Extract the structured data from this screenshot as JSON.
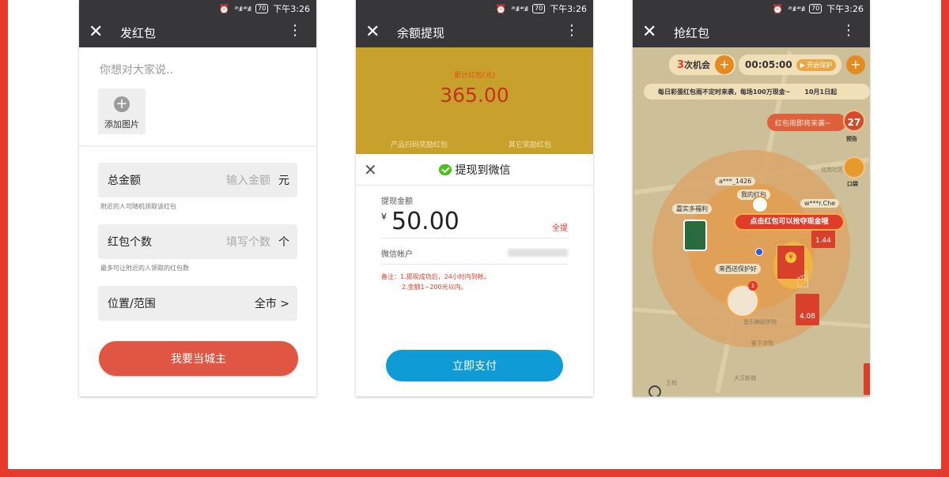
{
  "status": {
    "signal": "²⁶.ıll ⁴⁶.ıll",
    "battery": "70",
    "time": "下午3:26"
  },
  "colors": {
    "frame": "#e53a2e",
    "titlebar": "#37373a",
    "red_button": "#e05643",
    "blue_button": "#0f9bd6",
    "gold": "#c8a12c"
  },
  "phone1": {
    "title": "发红包",
    "message_placeholder": "你想对大家说..",
    "add_image_label": "添加图片",
    "total_label": "总金额",
    "total_placeholder": "输入金额",
    "total_unit": "元",
    "total_hint": "附近的人可随机领取该红包",
    "count_label": "红包个数",
    "count_placeholder": "填写个数",
    "count_unit": "个",
    "count_hint": "最多可让附近的人领取的红包数",
    "location_label": "位置/范围",
    "location_value": "全市 >",
    "submit_label": "我要当城主"
  },
  "phone2": {
    "title": "余额提现",
    "total_redpack_label": "累计红包(元)",
    "total_redpack_value": "365.00",
    "scan_reward_label": "产品扫码奖励红包",
    "other_reward_label": "其它奖励红包",
    "sheet_title": "提现到微信",
    "amount_label": "提现金额",
    "currency": "¥",
    "amount_value": "50.00",
    "withdraw_all_label": "全提",
    "account_label": "微信帐户",
    "note_line1": "备注：1.提现成功后，24小时内到帐。",
    "note_line2": "2.金额1~200元以内。",
    "pay_label": "立即支付"
  },
  "phone3": {
    "title": "抢红包",
    "chances_count": "3",
    "chances_label": "次机会",
    "timer": "00:05:00",
    "protect_label": "▶ 开启保护",
    "banner_left": "每日彩蛋红包雨不定时来袭，每场100万现金~",
    "banner_right": "10月1日起",
    "rain_label": "红包雨即将来袭~",
    "rain_count": "27",
    "preview_label": "预告",
    "bag_label": "口袋",
    "user_tag1": "a***_1426",
    "my_redpack": "我的红包",
    "user_tag2": "w***r.Che",
    "welfare_label": "嘉实多福利",
    "callout": "点击红包可以抢夺现金哦",
    "protect_tag": "来西送保护好",
    "env1_value": "1.44",
    "env2_value": "4.08",
    "badge_count": "1",
    "place1": "北苑社区",
    "place2": "音乐舞蹈学院",
    "place3": "郵下学院",
    "place4": "大汉新城",
    "place5": "王杨"
  }
}
